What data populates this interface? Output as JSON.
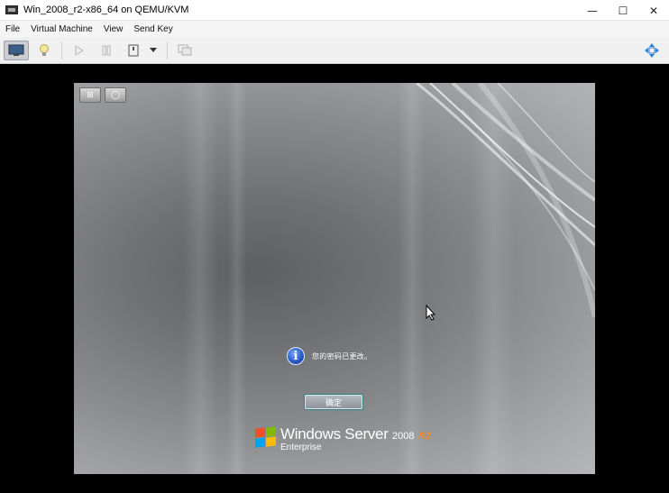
{
  "window": {
    "title": "Win_2008_r2-x86_64 on QEMU/KVM"
  },
  "window_controls": {
    "minimize": "—",
    "maximize": "☐",
    "close": "✕"
  },
  "menu": [
    "File",
    "Virtual Machine",
    "View",
    "Send Key"
  ],
  "toolbar": {
    "icons": [
      "console-icon",
      "details-lightbulb-icon",
      "run-icon",
      "pause-icon",
      "shutdown-icon",
      "shutdown-dropdown-icon",
      "snapshots-icon",
      "fullscreen-icon"
    ]
  },
  "vm_screen": {
    "top_buttons": [
      "⊞",
      "◯"
    ],
    "message": "您的密码已更改。",
    "ok_button": "确定",
    "brand": {
      "main": "Windows Server",
      "year": "2008",
      "release": "R2",
      "edition": "Enterprise"
    },
    "colors": {
      "accent_r2": "#f08c2a",
      "info_icon": "#2b5cc9"
    }
  }
}
